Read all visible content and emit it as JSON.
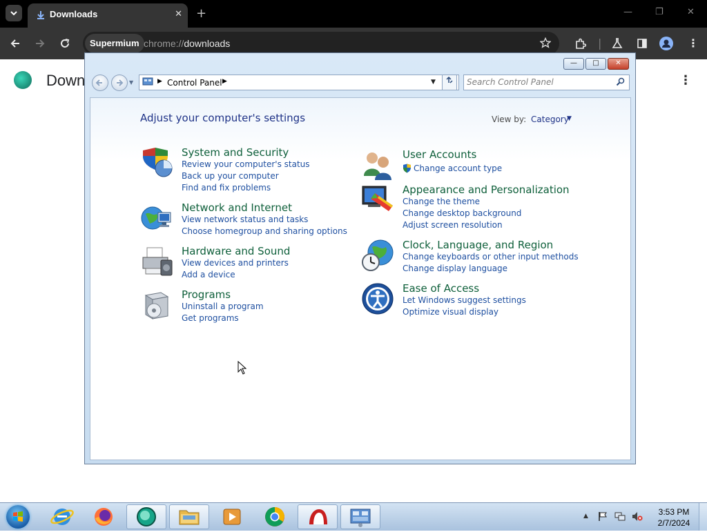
{
  "browser": {
    "tab_title": "Downloads",
    "tab_close": "✕",
    "new_tab": "+",
    "window_controls": [
      "—",
      "❐",
      "✕"
    ],
    "chip_label": "Supermium",
    "url_scheme": "chrome://",
    "url_host": "downloads",
    "page_title": "Down",
    "menu_glyph": "⋮",
    "accent": "#1a73e8"
  },
  "control_panel": {
    "window_buttons": [
      "—",
      "□",
      "✕"
    ],
    "breadcrumb": "Control Panel",
    "search_placeholder": "Search Control Panel",
    "heading": "Adjust your computer's settings",
    "view_by_label": "View by:",
    "view_by_value": "Category",
    "left_categories": [
      {
        "title": "System and Security",
        "icon": "shield-icon",
        "links": [
          "Review your computer's status",
          "Back up your computer",
          "Find and fix problems"
        ]
      },
      {
        "title": "Network and Internet",
        "icon": "network-globe-icon",
        "links": [
          "View network status and tasks",
          "Choose homegroup and sharing options"
        ]
      },
      {
        "title": "Hardware and Sound",
        "icon": "printer-icon",
        "links": [
          "View devices and printers",
          "Add a device"
        ]
      },
      {
        "title": "Programs",
        "icon": "programs-icon",
        "links": [
          "Uninstall a program",
          "Get programs"
        ]
      }
    ],
    "right_categories": [
      {
        "title": "User Accounts",
        "icon": "users-icon",
        "links": [
          "Change account type"
        ]
      },
      {
        "title": "Appearance and Personalization",
        "icon": "monitor-palette-icon",
        "links": [
          "Change the theme",
          "Change desktop background",
          "Adjust screen resolution"
        ]
      },
      {
        "title": "Clock, Language, and Region",
        "icon": "clock-globe-icon",
        "links": [
          "Change keyboards or other input methods",
          "Change display language"
        ]
      },
      {
        "title": "Ease of Access",
        "icon": "ease-of-access-icon",
        "links": [
          "Let Windows suggest settings",
          "Optimize visual display"
        ]
      }
    ],
    "title_color": "#0e5f3a",
    "link_color": "#1e4fa0"
  },
  "taskbar": {
    "pinned": [
      "start-orb",
      "internet-explorer-icon",
      "firefox-icon",
      "supermium-icon",
      "file-explorer-icon",
      "media-player-icon",
      "chrome-icon",
      "app-icon",
      "control-panel-icon"
    ],
    "clock_time": "3:53 PM",
    "clock_date": "2/7/2024"
  }
}
